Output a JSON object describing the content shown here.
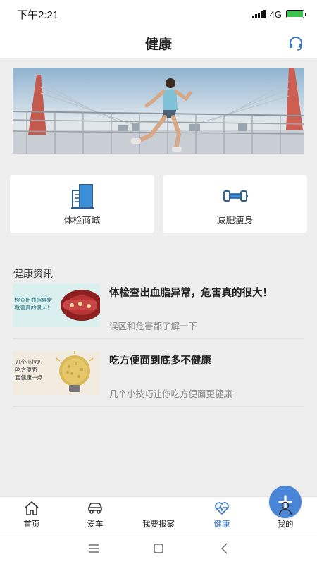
{
  "status_bar": {
    "time": "下午2:21",
    "network": "4G"
  },
  "header": {
    "title": "健康",
    "support_icon": "headset-icon"
  },
  "banner": {
    "icon": "running-man-banner"
  },
  "quick_actions": [
    {
      "label": "体检商城",
      "icon": "building-icon"
    },
    {
      "label": "减肥瘦身",
      "icon": "dumbbell-icon"
    }
  ],
  "news": {
    "section_title": "健康资讯",
    "items": [
      {
        "title": "体检查出血脂异常，危害真的很大！",
        "subtitle": "误区和危害都了解一下",
        "thumb_text": "检查出血脂异常\n危害真的很大！"
      },
      {
        "title": "吃方便面到底多不健康",
        "subtitle": "几个小技巧让你吃方便面更健康",
        "thumb_text": "几个小技巧\n吃方便面\n更健康一点"
      }
    ]
  },
  "tabbar": {
    "tabs": [
      {
        "label": "首页",
        "icon": "home-icon",
        "active": false
      },
      {
        "label": "爱车",
        "icon": "car-icon",
        "active": false
      },
      {
        "label": "我要报案",
        "icon": "plus-icon",
        "active": false
      },
      {
        "label": "健康",
        "icon": "heartbeat-icon",
        "active": true
      },
      {
        "label": "我的",
        "icon": "user-icon",
        "active": false
      }
    ],
    "active_color": "#3a78c9",
    "fab_color": "#4a86d8"
  },
  "system_nav": [
    "menu-icon",
    "home-square-icon",
    "back-icon"
  ]
}
